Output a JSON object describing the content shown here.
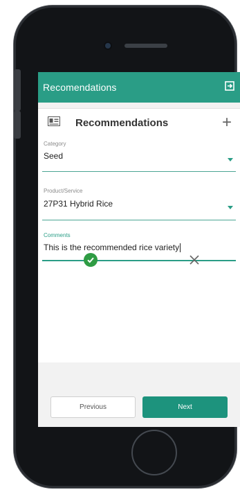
{
  "appbar": {
    "title": "Recomendations",
    "logout_icon": "logout-icon"
  },
  "card": {
    "title": "Recommendations",
    "header_icon": "id-card-icon",
    "add_icon": "plus-icon",
    "add_symbol": "+"
  },
  "form": {
    "category": {
      "label": "Category",
      "value": "Seed"
    },
    "product": {
      "label": "Product/Service",
      "value": "27P31 Hybrid Rice"
    },
    "comments": {
      "label": "Comments",
      "value": "This is the recommended rice variety"
    }
  },
  "actions": {
    "confirm_icon": "check-circle-icon",
    "cancel_icon": "close-icon"
  },
  "nav": {
    "previous": "Previous",
    "next": "Next"
  },
  "colors": {
    "primary": "#2a9d86",
    "next_button": "#1d937d",
    "confirm": "#2f9c44"
  }
}
